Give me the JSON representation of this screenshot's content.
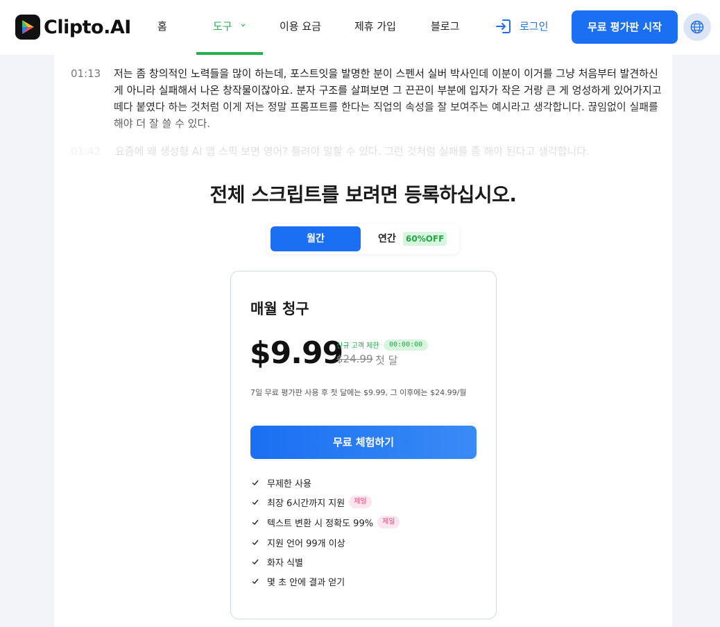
{
  "header": {
    "logo_text": "Clipto.AI",
    "nav": [
      {
        "label": "홈"
      },
      {
        "label": "도구"
      },
      {
        "label": "이용 요금"
      },
      {
        "label": "제휴 가입"
      },
      {
        "label": "블로그"
      }
    ],
    "login_label": "로그인",
    "trial_label": "무료 평가판 시작",
    "active_color": "#22b14c",
    "accent_color": "#1a6ff2"
  },
  "transcript": [
    {
      "time": "01:13",
      "text": "저는 좀 창의적인 노력들을 많이 하는데, 포스트잇을 발명한 분이 스펜서 실버 박사인데 이분이 이거를 그냥 처음부터 발견하신 게 아니라 실패해서 나온 창작물이잖아요. 분자 구조를 살펴보면 그 끈끈이 부분에 입자가 작은 거랑 큰 게 엉성하게 있어가지고 떼다 붙였다 하는 것처럼 이게 저는 정말 프롬프트를 한다는 직업의 속성을 잘 보여주는 예시라고 생각합니다. 끊임없이 실패를 해야 더 잘 쓸 수 있다."
    },
    {
      "time": "01:42",
      "text": "요즘에 왜 생성형 AI 앱 스픽 보면 영어? 틀려야 말할 수 있다. 그런 것처럼 실패를 좀 해야 된다고 생각합니다."
    }
  ],
  "cta": {
    "title": "전체 스크립트를 보려면 등록하십시오.",
    "toggle": {
      "monthly": "월간",
      "yearly": "연간",
      "discount": "60%OFF"
    }
  },
  "plan": {
    "title": "매월 청구",
    "price": "$9.99",
    "promo_label": "신규 고객 제한",
    "timer": "00:00:00",
    "old_price": "$24.99",
    "old_price_suffix": "첫 달",
    "note": "7일 무료 평가판 사용 후 첫 달에는 $9.99, 그 이후에는 $24.99/월",
    "button": "무료 체험하기",
    "features": [
      {
        "label": "무제한 사용",
        "badge": ""
      },
      {
        "label": "최장 6시간까지 지원",
        "badge": "제일"
      },
      {
        "label": "텍스트 변환 시 정확도 99%",
        "badge": "제일"
      },
      {
        "label": "지원 언어 99개 이상",
        "badge": ""
      },
      {
        "label": "화자 식별",
        "badge": ""
      },
      {
        "label": "몇 초 안에 결과 얻기",
        "badge": ""
      }
    ]
  },
  "icons": {
    "logo": "clipto-logo-icon",
    "login": "login-arrow-icon",
    "language": "globe-icon",
    "dropdown": "chevron-down-icon",
    "feature": "check-icon"
  }
}
